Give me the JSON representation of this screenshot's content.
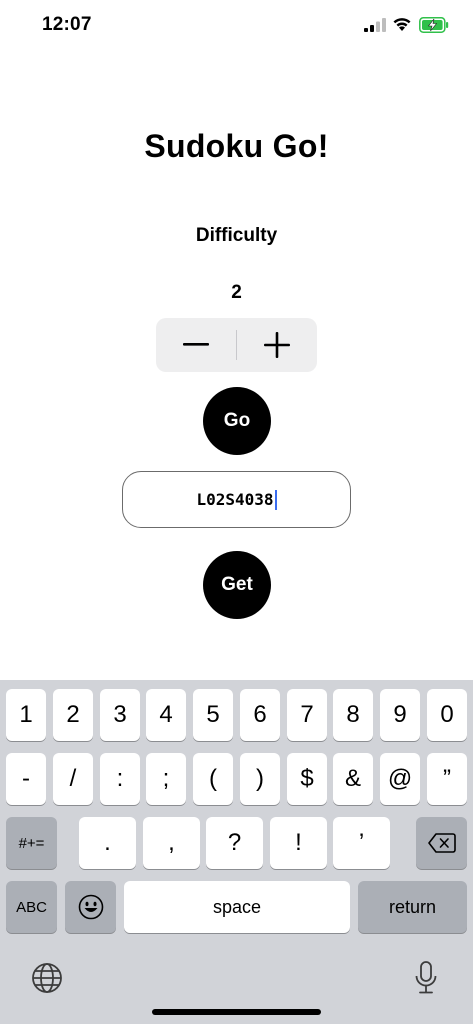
{
  "status_bar": {
    "time": "12:07",
    "signal_icon": "cellular-signal-icon",
    "wifi_icon": "wifi-icon",
    "battery_icon": "battery-charging-icon"
  },
  "app": {
    "title": "Sudoku Go!",
    "difficulty_label": "Difficulty",
    "difficulty_value": "2",
    "stepper": {
      "minus": "−",
      "plus": "+"
    },
    "go_label": "Go",
    "code_input_value": "L02S4038",
    "get_label": "Get"
  },
  "keyboard": {
    "row1": [
      "1",
      "2",
      "3",
      "4",
      "5",
      "6",
      "7",
      "8",
      "9",
      "0"
    ],
    "row2": [
      "-",
      "/",
      ":",
      ";",
      "(",
      ")",
      "$",
      "&",
      "@",
      "”"
    ],
    "row3": [
      ".",
      ",",
      "?",
      "!",
      "’"
    ],
    "symbols_toggle": "#+=",
    "abc_key": "ABC",
    "space_key": "space",
    "return_key": "return",
    "delete_icon": "backspace-icon",
    "emoji_icon": "emoji-icon",
    "globe_icon": "globe-icon",
    "mic_icon": "microphone-icon"
  },
  "colors": {
    "caret": "#3a6df0",
    "battery": "#30c04a",
    "keyboard_bg": "#d1d3d8"
  }
}
